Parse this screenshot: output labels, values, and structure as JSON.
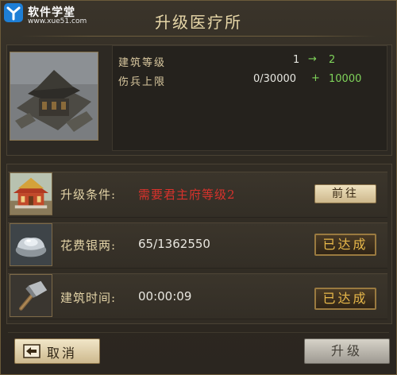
{
  "watermark": {
    "site_name": "软件学堂",
    "url": "www.xue51.com"
  },
  "dialog": {
    "title": "升级医疗所"
  },
  "stats": {
    "level": {
      "label": "建筑等级",
      "current": "1",
      "arrow": "→",
      "next": "2"
    },
    "wounded_cap": {
      "label": "伤兵上限",
      "current": "0/30000",
      "plus": "+",
      "increase": "10000"
    }
  },
  "requirements": [
    {
      "label": "升级条件:",
      "value": "需要君主府等级2",
      "action": "前往",
      "icon": "palace-icon"
    },
    {
      "label": "花费银两:",
      "value": "65/1362550",
      "action": "已达成",
      "icon": "silver-ingot-icon"
    },
    {
      "label": "建筑时间:",
      "value": "00:00:09",
      "action": "已达成",
      "icon": "hammer-icon"
    }
  ],
  "footer": {
    "cancel_label": "取消",
    "upgrade_label": "升级"
  },
  "colors": {
    "gold_text": "#e2d2a6",
    "red_requirement": "#d8322c",
    "green_increase": "#7fd35a",
    "done_gold": "#e8b84a"
  }
}
